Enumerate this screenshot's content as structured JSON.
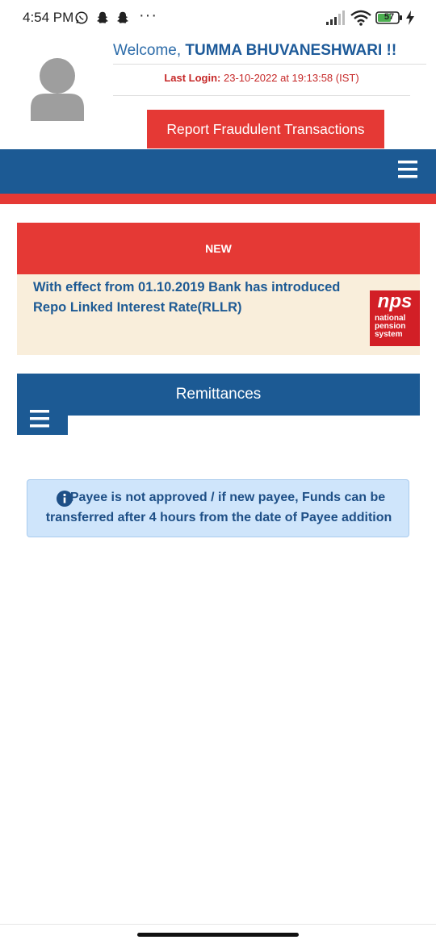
{
  "status_bar": {
    "time": "4:54 PM",
    "dots": "···",
    "battery_level": "57"
  },
  "header": {
    "welcome_prefix": "Welcome, ",
    "user_name": "TUMMA BHUVANESHWARI !!",
    "last_login_label": "Last Login:",
    "last_login_value": " 23-10-2022 at 19:13:58 (IST)",
    "report_button_label": "Report Fraudulent Transactions"
  },
  "colors": {
    "brand_blue": "#1c5a94",
    "brand_red": "#e53935",
    "notice_bg": "#f9eedb",
    "info_bg": "#cfe5fb"
  },
  "notice": {
    "badge": "NEW",
    "text": "With effect from 01.10.2019 Bank has introduced Repo Linked Interest Rate(RLLR)",
    "logo": {
      "big": "nps",
      "line1": "national",
      "line2": "pension",
      "line3": "system"
    }
  },
  "remittances": {
    "title": "Remittances"
  },
  "info": {
    "text": "Payee is not approved / if new payee, Funds can be transferred after 4 hours from the date of Payee addition"
  }
}
